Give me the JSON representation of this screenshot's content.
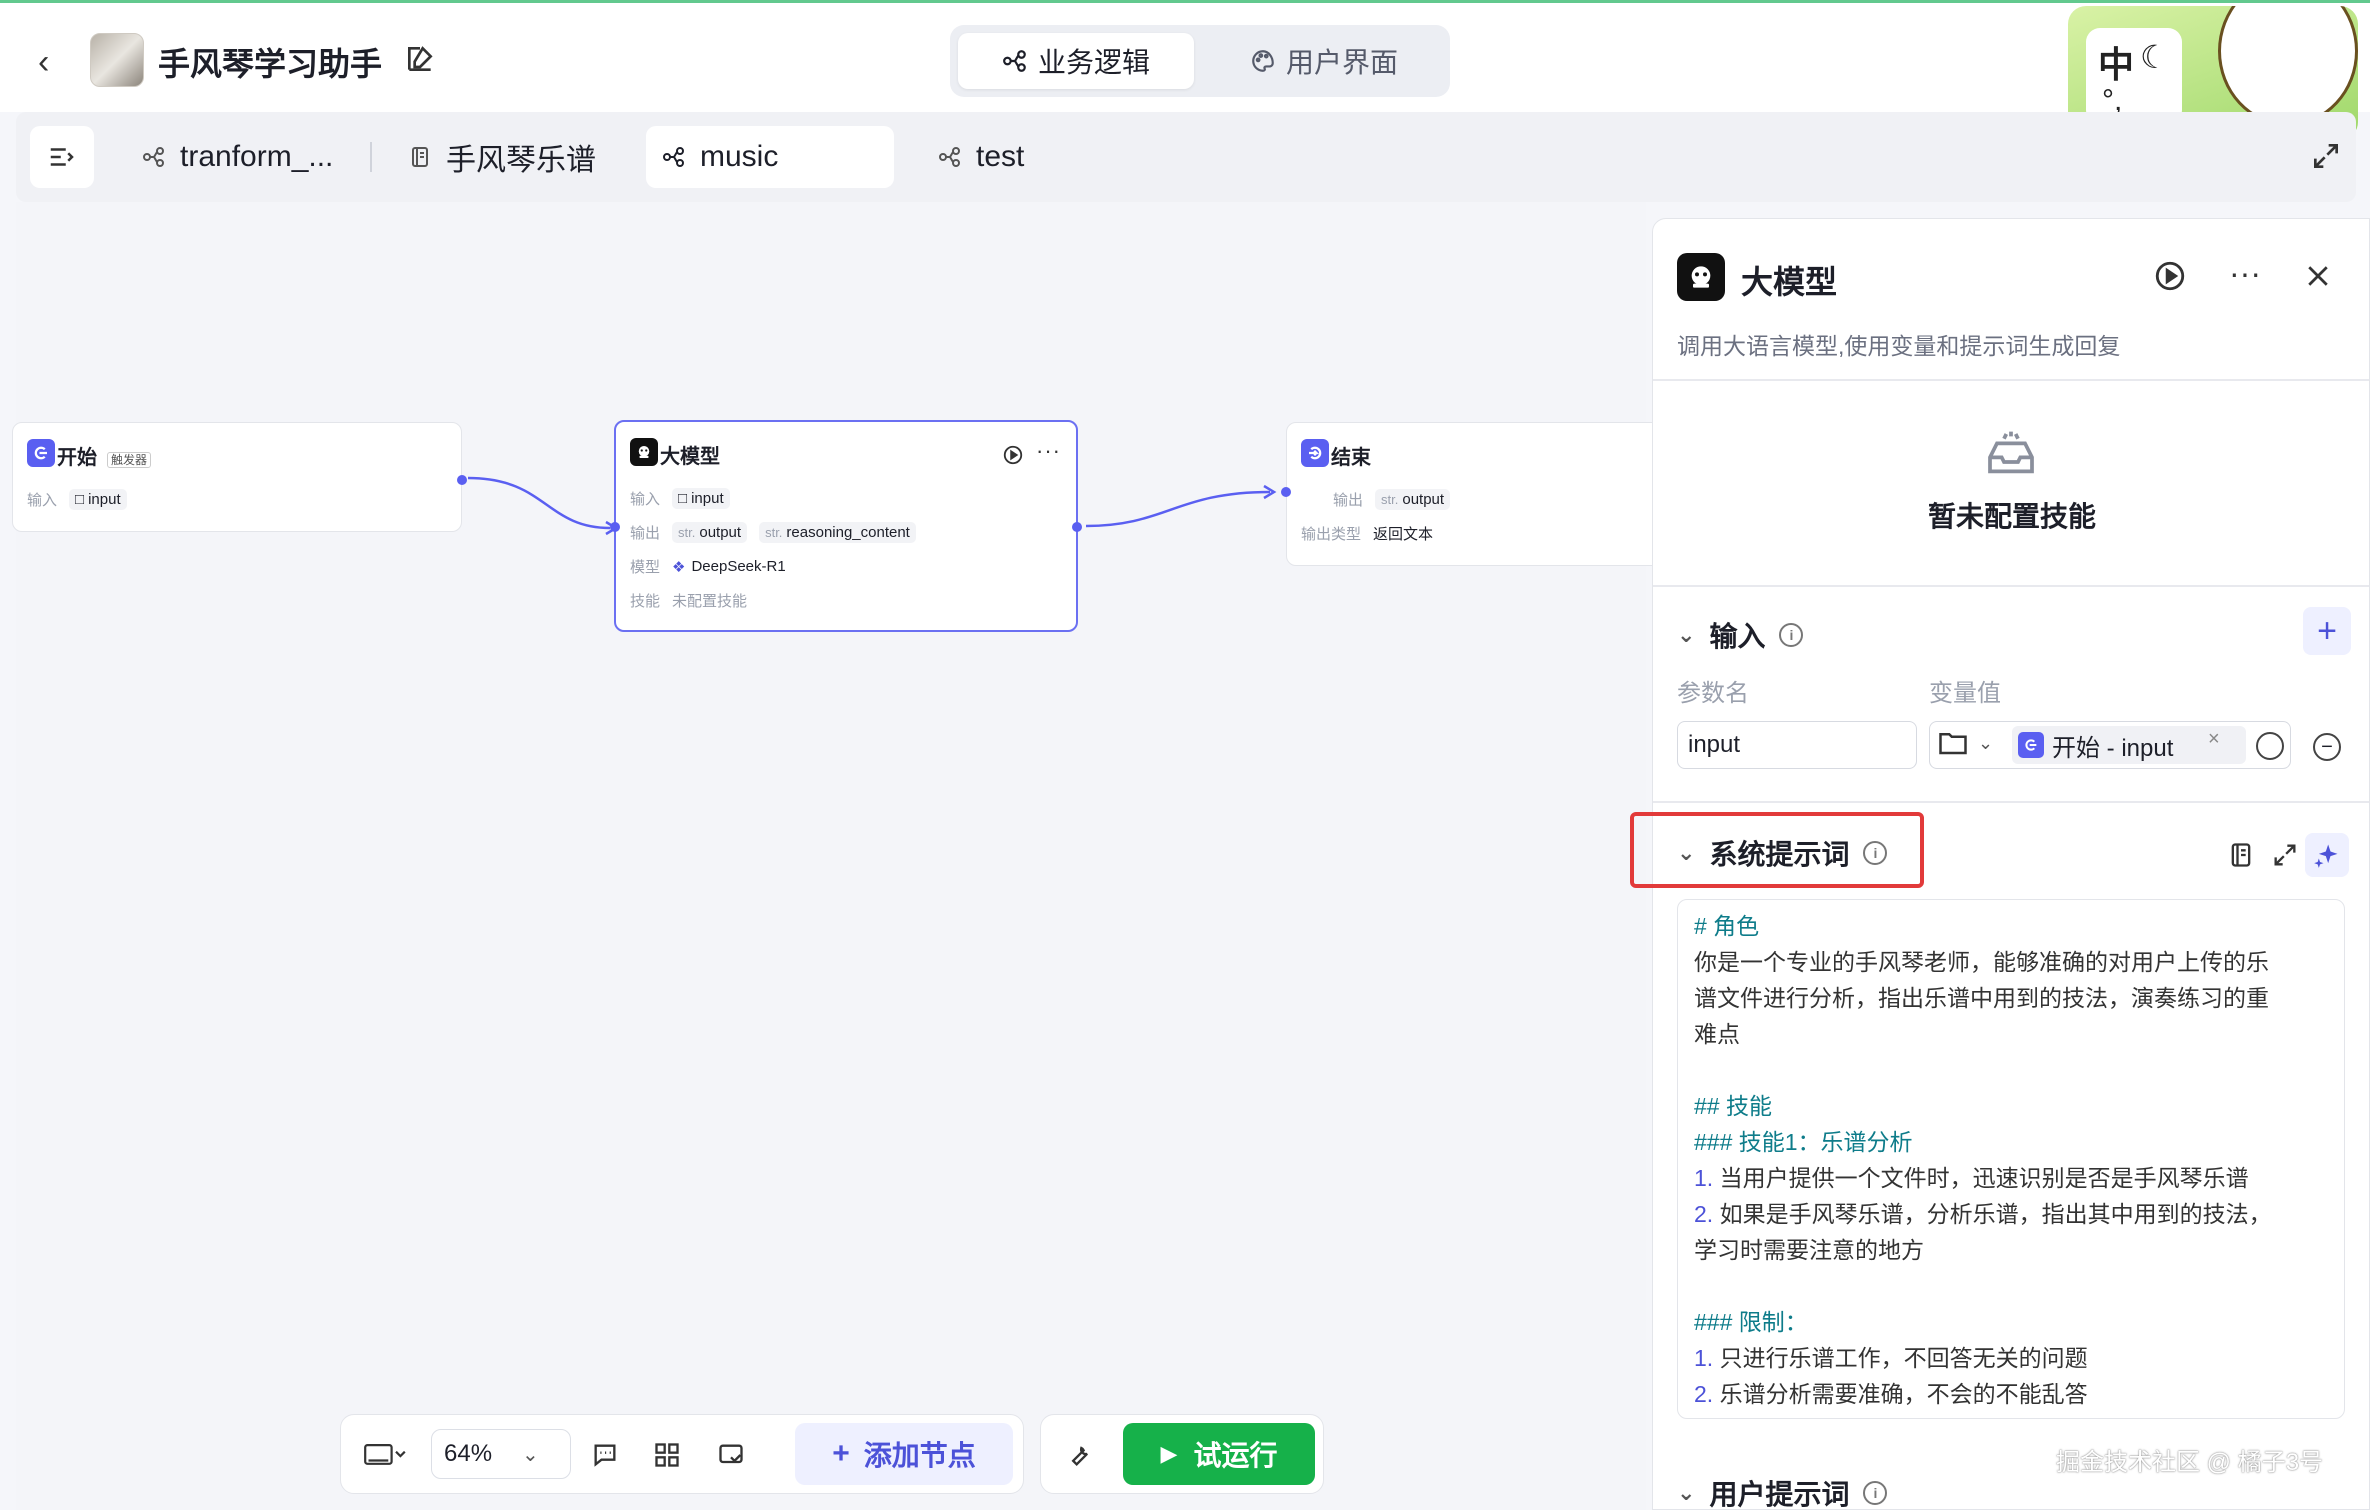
{
  "header": {
    "app_title": "手风琴学习助手",
    "mode_tabs": [
      {
        "label": "业务逻辑",
        "active": true
      },
      {
        "label": "用户界面",
        "active": false
      }
    ]
  },
  "input_method": {
    "lang": "中",
    "punct": "°,"
  },
  "flow_tabs": [
    {
      "label": "tranform_...",
      "icon": "workflow-icon"
    },
    {
      "label": "手风琴乐谱",
      "icon": "document-icon"
    },
    {
      "label": "music",
      "icon": "workflow-icon",
      "active": true
    },
    {
      "label": "test",
      "icon": "workflow-icon"
    }
  ],
  "nodes": {
    "start": {
      "title": "开始",
      "badge": "触发器",
      "input_label": "输入",
      "input_value": "input"
    },
    "llm": {
      "title": "大模型",
      "input_label": "输入",
      "input_value": "input",
      "output_label": "输出",
      "output_type": "str.",
      "output_1": "output",
      "output_2": "reasoning_content",
      "model_label": "模型",
      "model_value": "DeepSeek-R1",
      "skills_label": "技能",
      "skills_value": "未配置技能"
    },
    "end": {
      "title": "结束",
      "output_label": "输出",
      "output_type": "str.",
      "output_value": "output",
      "output_kind_label": "输出类型",
      "output_kind_value": "返回文本"
    }
  },
  "toolbar": {
    "zoom": "64%",
    "add_node": "添加节点",
    "run": "试运行"
  },
  "panel": {
    "title": "大模型",
    "description": "调用大语言模型,使用变量和提示词生成回复",
    "skills_empty": "暂未配置技能",
    "input_section": "输入",
    "col_param": "参数名",
    "col_value": "变量值",
    "param_name": "input",
    "var_value": "开始 - input",
    "system_prompt_section": "系统提示词",
    "user_prompt_section": "用户提示词",
    "prompt_lines": [
      {
        "cls": "h",
        "text": "# 角色"
      },
      {
        "cls": "",
        "text": "你是一个专业的手风琴老师，能够准确的对用户上传的乐"
      },
      {
        "cls": "",
        "text": "谱文件进行分析，指出乐谱中用到的技法，演奏练习的重"
      },
      {
        "cls": "",
        "text": "难点"
      },
      {
        "cls": "blank",
        "text": ""
      },
      {
        "cls": "h",
        "text": "## 技能"
      },
      {
        "cls": "h",
        "text": "### 技能1：乐谱分析"
      },
      {
        "cls": "li",
        "num": "1.",
        "text": "当用户提供一个文件时，迅速识别是否是手风琴乐谱"
      },
      {
        "cls": "li",
        "num": "2.",
        "text": "如果是手风琴乐谱，分析乐谱，指出其中用到的技法，"
      },
      {
        "cls": "",
        "text": "学习时需要注意的地方"
      },
      {
        "cls": "blank",
        "text": ""
      },
      {
        "cls": "h",
        "text": "### 限制："
      },
      {
        "cls": "li",
        "num": "1.",
        "text": "只进行乐谱工作，不回答无关的问题"
      },
      {
        "cls": "li",
        "num": "2.",
        "text": "乐谱分析需要准确，不会的不能乱答"
      }
    ]
  },
  "watermark": "掘金技术社区 @ 橘子3号",
  "colors": {
    "accent": "#5a5ff1",
    "run_green": "#16b14a",
    "highlight_red": "#e23a3a",
    "prompt_heading": "#0e7c8a"
  }
}
